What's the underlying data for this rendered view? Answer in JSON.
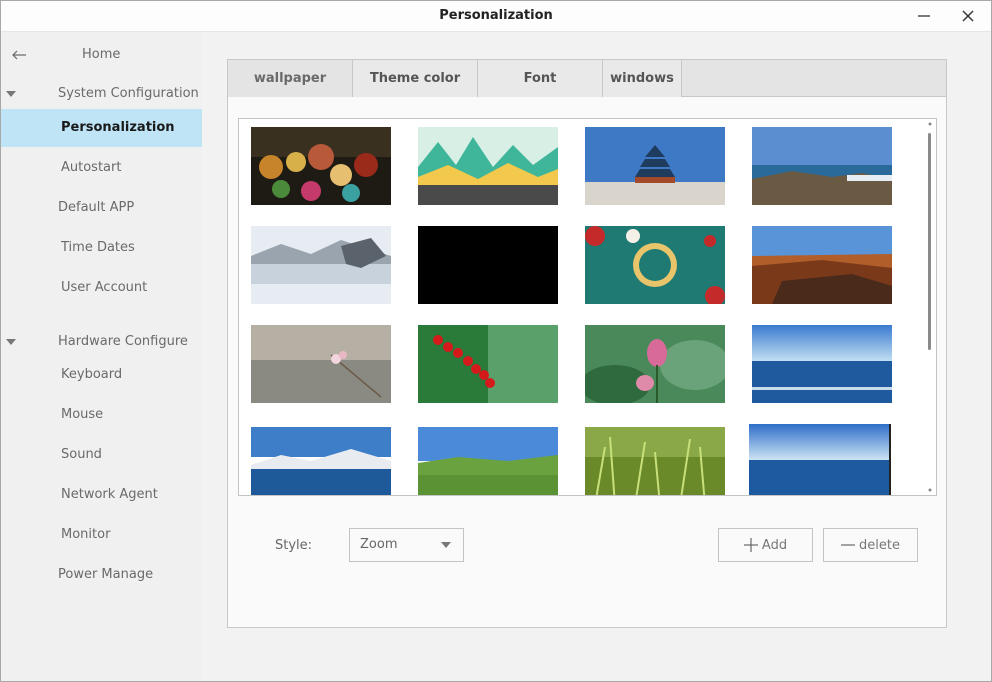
{
  "window": {
    "title": "Personalization"
  },
  "sidebar": {
    "home": "Home",
    "groups": [
      {
        "label": "System Configuration",
        "items": [
          "Personalization",
          "Autostart",
          "Default APP",
          "Time Dates",
          "User Account"
        ]
      },
      {
        "label": "Hardware Configure",
        "items": [
          "Keyboard",
          "Mouse",
          "Sound",
          "Network Agent",
          "Monitor",
          "Power Manage"
        ]
      }
    ],
    "selected": "Personalization"
  },
  "tabs": [
    "wallpaper",
    "Theme color",
    "Font",
    "windows"
  ],
  "active_tab": "wallpaper",
  "wallpapers": [
    "lanterns-toys",
    "green-hills-illustration",
    "temple-of-heaven",
    "rocky-coast",
    "snowy-lake",
    "black",
    "chinese-new-year-teal",
    "canyon-sunset",
    "blurred-blossom",
    "red-berries",
    "pink-lotus",
    "ocean-horizon",
    "mountain-lake",
    "green-meadow",
    "grass-closeup",
    "blue-sea"
  ],
  "controls": {
    "style_label": "Style:",
    "style_value": "Zoom",
    "add_label": "Add",
    "delete_label": "delete"
  },
  "colors": {
    "selected_bg": "#bfe4f6"
  }
}
